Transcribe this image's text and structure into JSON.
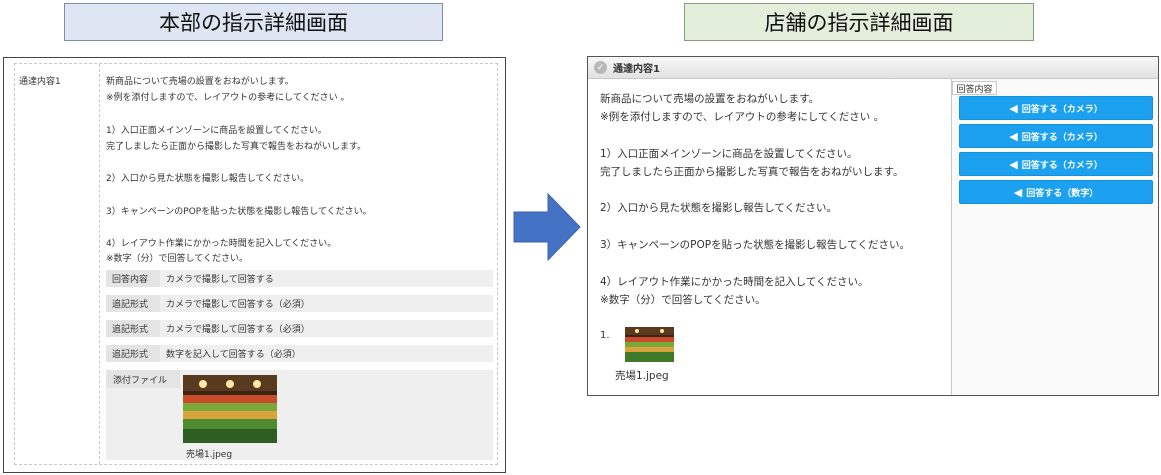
{
  "headers": {
    "hq": "本部の指示詳細画面",
    "store": "店舗の指示詳細画面"
  },
  "hq": {
    "label": "通達内容1",
    "lines": [
      "新商品について売場の設置をおねがいします。",
      "※例を添付しますので、レイアウトの参考にしてください 。",
      "1）入口正面メインゾーンに商品を設置してください。",
      "完了しましたら正面から撮影した写真で報告をおねがいします。",
      "2）入口から見た状態を撮影し報告してください。",
      "3）キャンペーンのPOPを貼った状態を撮影し報告してください。",
      "4）レイアウト作業にかかった時間を記入してください。",
      "※数字（分）で回答してください。"
    ],
    "rows": [
      {
        "key": "回答内容",
        "value": "カメラで撮影して回答する"
      },
      {
        "key": "追記形式",
        "value": "カメラで撮影して回答する（必須）"
      },
      {
        "key": "追記形式",
        "value": "カメラで撮影して回答する（必須）"
      },
      {
        "key": "追記形式",
        "value": "数字を記入して回答する（必須）"
      }
    ],
    "attachment_label": "添付ファイル",
    "attachment_name": "売場1.jpeg"
  },
  "store": {
    "title": "通達内容1",
    "lines": [
      "新商品について売場の設置をおねがいします。",
      "※例を添付しますので、レイアウトの参考にしてください 。",
      "1）入口正面メインゾーンに商品を設置してください。",
      "完了しましたら正面から撮影した写真で報告をおねがいします。",
      "2）入口から見た状態を撮影し報告してください。",
      "3）キャンペーンのPOPを貼った状態を撮影し報告してください。",
      "4）レイアウト作業にかかった時間を記入してください。",
      "※数字（分）で回答してください。"
    ],
    "attachment_number": "1.",
    "attachment_name": "売場1.jpeg",
    "answer_tab": "回答内容",
    "buttons": [
      "回答する（カメラ）",
      "回答する（カメラ）",
      "回答する（カメラ）",
      "回答する（数字）"
    ]
  },
  "colors": {
    "button": "#1ba1f0",
    "arrow": "#4472c4"
  }
}
